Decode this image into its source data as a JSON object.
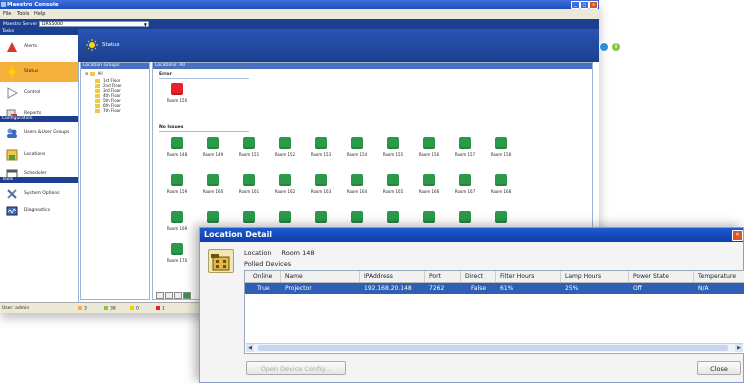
{
  "window": {
    "title": "Maestro Console"
  },
  "menu": [
    "File",
    "Tools",
    "Help"
  ],
  "server": {
    "label": "Maestro Server",
    "value": "DRS5000"
  },
  "sidebar": {
    "sections": [
      {
        "title": "Tasks",
        "items": [
          {
            "label": "Alerts",
            "icon": "alert-triangle-icon"
          },
          {
            "label": "Status",
            "icon": "sun-icon",
            "active": true
          },
          {
            "label": "Control",
            "icon": "play-icon"
          },
          {
            "label": "Reports",
            "icon": "report-icon"
          }
        ]
      },
      {
        "title": "Configuration",
        "items": [
          {
            "label": "Users &User Groups",
            "icon": "users-icon"
          },
          {
            "label": "Locations",
            "icon": "location-icon"
          },
          {
            "label": "Scheduler",
            "icon": "calendar-icon"
          }
        ]
      },
      {
        "title": "Tools",
        "items": [
          {
            "label": "System Options",
            "icon": "tools-icon"
          },
          {
            "label": "Diagnostics",
            "icon": "diagnostics-icon"
          }
        ]
      }
    ]
  },
  "header": {
    "title": "Status"
  },
  "location_groups": {
    "title": "Location Groups",
    "root": "All",
    "children": [
      "1st Floor",
      "2nd Floor",
      "3rd Floor",
      "4th Floor",
      "5th Floor",
      "6th Floor",
      "7th Floor"
    ]
  },
  "locations": {
    "title": "Locations: All",
    "error_title": "Error",
    "error_rooms": [
      "Room 150"
    ],
    "ok_title": "No Issues",
    "ok_rows": [
      [
        "Room 148",
        "Room 149",
        "Room 151",
        "Room 152",
        "Room 153",
        "Room 154",
        "Room 155",
        "Room 156",
        "Room 157",
        "Room 158"
      ],
      [
        "Room 159",
        "Room 160",
        "Room 161",
        "Room 162",
        "Room 163",
        "Room 164",
        "Room 165",
        "Room 166",
        "Room 167",
        "Room 168"
      ],
      [
        "Room 169",
        "",
        "",
        "",
        "",
        "",
        "",
        "",
        "",
        ""
      ],
      [
        "Room 170"
      ]
    ]
  },
  "statusbar": {
    "user": "User: admin",
    "counts": [
      {
        "value": "3",
        "color": "#f5b13c"
      },
      {
        "value": "38",
        "color": "#8bc43f"
      },
      {
        "value": "0",
        "color": "#f0d000"
      },
      {
        "value": "1",
        "color": "#e8212a"
      }
    ]
  },
  "dialog": {
    "title": "Location Detail",
    "location_label": "Location",
    "location_value": "Room 148",
    "polled_label": "Polled Devices",
    "columns": [
      "Online",
      "Name",
      "IPAddress",
      "Port",
      "Direct",
      "Filter Hours",
      "Lamp Hours",
      "Power State",
      "Temperature"
    ],
    "rows": [
      [
        "True",
        "Projector",
        "192.168.20.148",
        "7262",
        "False",
        "61%",
        "25%",
        "Off",
        "N/A"
      ]
    ],
    "open_config_label": "Open Device Config...",
    "close_label": "Close"
  }
}
